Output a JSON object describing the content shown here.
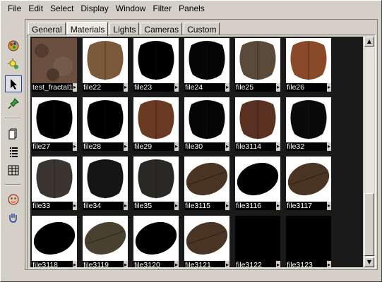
{
  "menu": [
    "File",
    "Edit",
    "Select",
    "Display",
    "Window",
    "Filter",
    "Panels"
  ],
  "tabs": [
    {
      "label": "General",
      "active": false
    },
    {
      "label": "Materials",
      "active": true
    },
    {
      "label": "Lights",
      "active": false
    },
    {
      "label": "Cameras",
      "active": false
    },
    {
      "label": "Custom",
      "active": false
    }
  ],
  "toolbar": [
    {
      "name": "render-icon"
    },
    {
      "name": "light-icon"
    },
    {
      "name": "select-arrow-icon",
      "selected": true
    },
    {
      "name": "pin-icon"
    },
    {
      "name": "icon-view-icon"
    },
    {
      "name": "list-view-icon"
    },
    {
      "name": "detail-view-icon"
    },
    {
      "name": "face-icon"
    },
    {
      "name": "hand-icon"
    }
  ],
  "swatches": [
    {
      "label": "test_fractal1",
      "kind": "fractal",
      "fill": "#6b5040"
    },
    {
      "label": "file22",
      "kind": "feather",
      "fill": "#7a5a3a"
    },
    {
      "label": "file23",
      "kind": "feather",
      "fill": "#000000"
    },
    {
      "label": "file24",
      "kind": "feather",
      "fill": "#050505"
    },
    {
      "label": "file25",
      "kind": "feather",
      "fill": "#5a4a3a"
    },
    {
      "label": "file26",
      "kind": "feather",
      "fill": "#8a4a2a"
    },
    {
      "label": "file27",
      "kind": "feather",
      "fill": "#000000"
    },
    {
      "label": "file28",
      "kind": "feather",
      "fill": "#000000"
    },
    {
      "label": "file29",
      "kind": "feather",
      "fill": "#6a3a22"
    },
    {
      "label": "file30",
      "kind": "feather",
      "fill": "#050505"
    },
    {
      "label": "file3114",
      "kind": "feather",
      "fill": "#5a3020"
    },
    {
      "label": "file32",
      "kind": "feather",
      "fill": "#0a0a0a"
    },
    {
      "label": "file33",
      "kind": "feather",
      "fill": "#3a3530"
    },
    {
      "label": "file34",
      "kind": "feather",
      "fill": "#151515"
    },
    {
      "label": "file35",
      "kind": "feather",
      "fill": "#2a2825"
    },
    {
      "label": "file3115",
      "kind": "wing",
      "fill": "#4a3525"
    },
    {
      "label": "file3116",
      "kind": "wing",
      "fill": "#000000"
    },
    {
      "label": "file3117",
      "kind": "wing",
      "fill": "#4a3525"
    },
    {
      "label": "file3118",
      "kind": "wing",
      "fill": "#000000"
    },
    {
      "label": "file3119",
      "kind": "wing",
      "fill": "#4a4030"
    },
    {
      "label": "file3120",
      "kind": "wing",
      "fill": "#000000"
    },
    {
      "label": "file3121",
      "kind": "wing",
      "fill": "#4a3525"
    },
    {
      "label": "file3122",
      "kind": "empty",
      "fill": "#000000"
    },
    {
      "label": "file3123",
      "kind": "empty",
      "fill": "#000000"
    }
  ]
}
